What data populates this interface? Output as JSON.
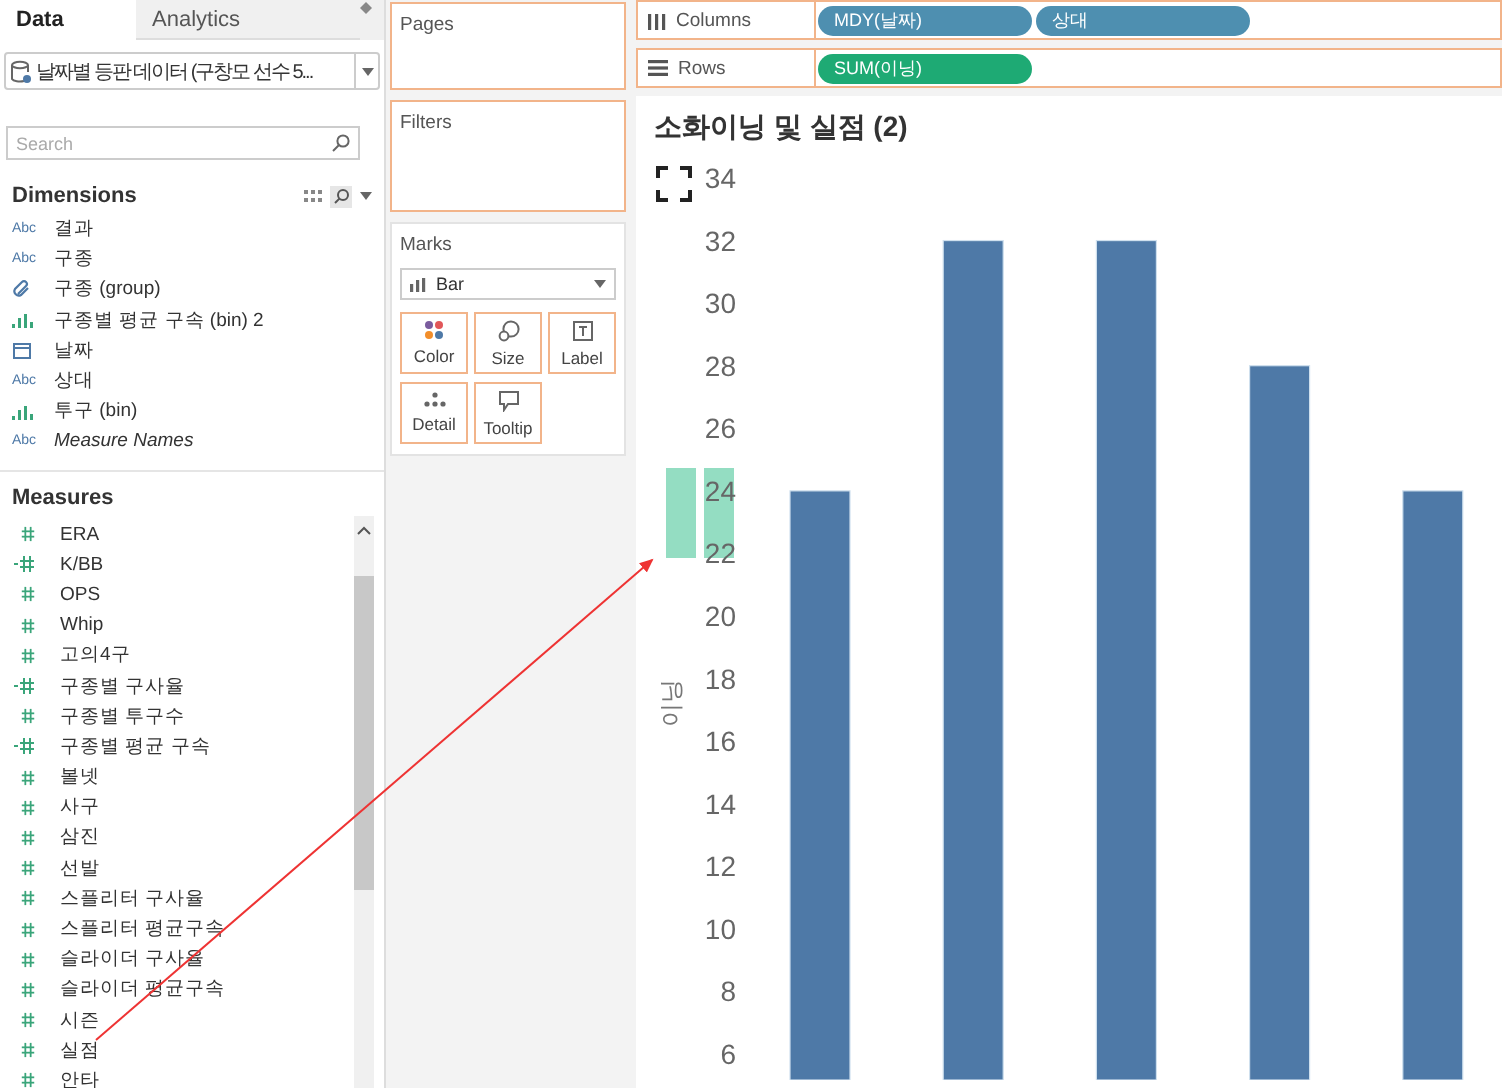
{
  "tabs": [
    {
      "label": "Data",
      "selected": true
    },
    {
      "label": "Analytics",
      "selected": false
    }
  ],
  "datasource": {
    "label": "날짜별 등판 데이터 (구창모 선수 5..."
  },
  "search": {
    "placeholder": "Search"
  },
  "dimensions": {
    "title": "Dimensions",
    "items": [
      {
        "kind": "text",
        "type_text": "Abc",
        "name": "결과",
        "italic": false
      },
      {
        "kind": "text",
        "type_text": "Abc",
        "name": "구종",
        "italic": false
      },
      {
        "kind": "group",
        "name": "구종 (group)",
        "italic": false
      },
      {
        "kind": "bin",
        "name": "구종별 평균 구속 (bin) 2",
        "italic": false
      },
      {
        "kind": "date",
        "name": "날짜",
        "italic": false
      },
      {
        "kind": "text",
        "type_text": "Abc",
        "name": "상대",
        "italic": false
      },
      {
        "kind": "bin",
        "name": "투구 (bin)",
        "italic": false
      },
      {
        "kind": "text",
        "type_text": "Abc",
        "name": "Measure Names",
        "italic": true
      }
    ]
  },
  "measures": {
    "title": "Measures",
    "items": [
      {
        "kind": "measure",
        "name": "ERA"
      },
      {
        "kind": "calc",
        "name": "K/BB"
      },
      {
        "kind": "measure",
        "name": "OPS"
      },
      {
        "kind": "measure",
        "name": "Whip"
      },
      {
        "kind": "measure",
        "name": "고의4구"
      },
      {
        "kind": "calc",
        "name": "구종별 구사율"
      },
      {
        "kind": "measure",
        "name": "구종별 투구수"
      },
      {
        "kind": "calc",
        "name": "구종별 평균 구속"
      },
      {
        "kind": "measure",
        "name": "볼넷"
      },
      {
        "kind": "measure",
        "name": "사구"
      },
      {
        "kind": "measure",
        "name": "삼진"
      },
      {
        "kind": "measure",
        "name": "선발"
      },
      {
        "kind": "measure",
        "name": "스플리터 구사율"
      },
      {
        "kind": "measure",
        "name": "스플리터 평균구속"
      },
      {
        "kind": "measure",
        "name": "슬라이더 구사율"
      },
      {
        "kind": "measure",
        "name": "슬라이더 평균구속"
      },
      {
        "kind": "measure",
        "name": "시즌"
      },
      {
        "kind": "measure",
        "name": "실점"
      },
      {
        "kind": "measure",
        "name": "안타"
      }
    ]
  },
  "cards": {
    "pages": "Pages",
    "filters": "Filters",
    "marks": {
      "title": "Marks",
      "type": "Bar",
      "buttons": [
        {
          "kind": "color",
          "label": "Color"
        },
        {
          "kind": "size",
          "label": "Size"
        },
        {
          "kind": "label",
          "label": "Label"
        },
        {
          "kind": "detail",
          "label": "Detail"
        },
        {
          "kind": "tooltip",
          "label": "Tooltip"
        }
      ]
    }
  },
  "shelves": [
    {
      "kind": "columns",
      "label": "Columns",
      "pills": [
        {
          "label": "MDY(날짜)",
          "color": "#4e8fb0"
        },
        {
          "label": "상대",
          "color": "#4e8fb0"
        }
      ]
    },
    {
      "kind": "rows",
      "label": "Rows",
      "pills": [
        {
          "label": "SUM(이닝)",
          "color": "#1eaa74"
        }
      ]
    }
  ],
  "view": {
    "title": "소화이닝 및 실점 (2)",
    "chart_data": {
      "type": "bar",
      "ylabel": "이닝",
      "series": [
        {
          "color": "#4e79a7",
          "values": [
            24,
            32,
            32,
            28,
            24
          ]
        }
      ],
      "ylim": [
        6,
        34
      ],
      "yticks": [
        6,
        8,
        10,
        12,
        14,
        16,
        18,
        20,
        22,
        24,
        26,
        28,
        30,
        32,
        34
      ]
    }
  }
}
